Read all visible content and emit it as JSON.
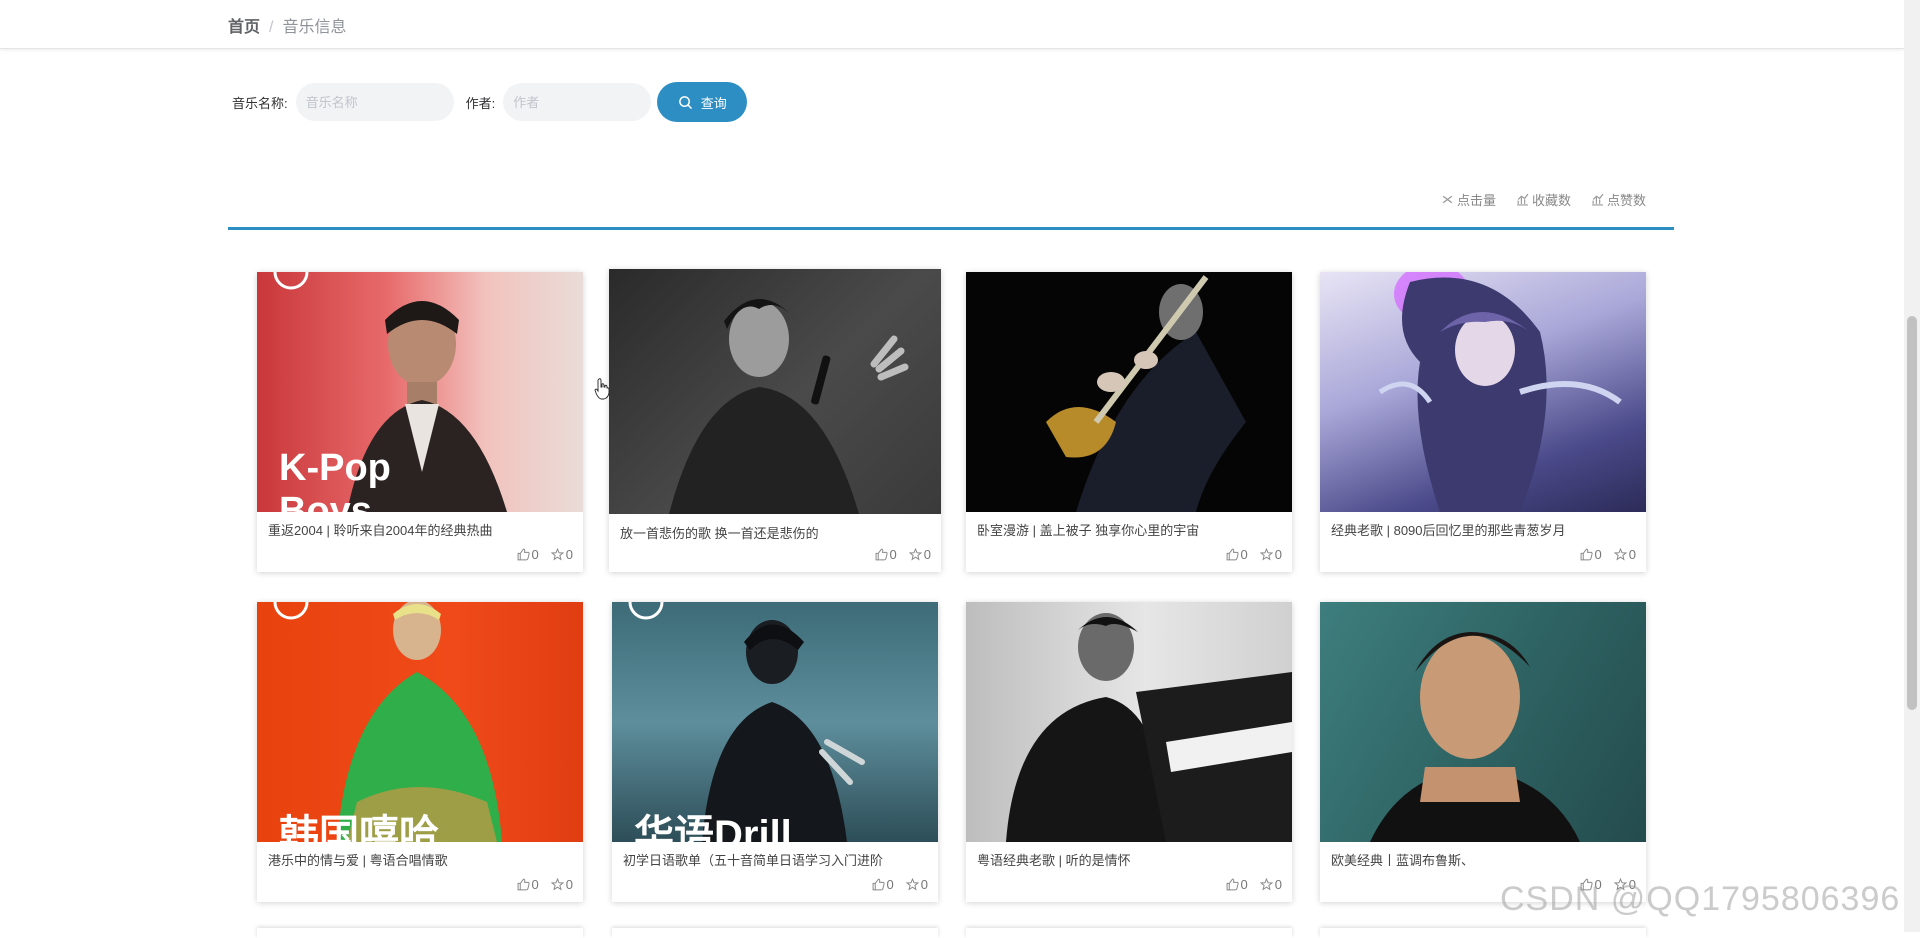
{
  "breadcrumb": {
    "home": "首页",
    "separator": "/",
    "current": "音乐信息"
  },
  "search": {
    "name_label": "音乐名称:",
    "name_placeholder": "音乐名称",
    "author_label": "作者:",
    "author_placeholder": "作者",
    "button_label": "查询"
  },
  "sorts": [
    {
      "label": "点击量",
      "icon": "sort-icon"
    },
    {
      "label": "收藏数",
      "icon": "chart-icon"
    },
    {
      "label": "点赞数",
      "icon": "chart-icon"
    }
  ],
  "cards": [
    {
      "title": "重返2004 | 聆听来自2004年的经典热曲",
      "likes": "0",
      "favorites": "0",
      "cover_text": "K-Pop",
      "cover_text2": "Boys"
    },
    {
      "title": "放一首悲伤的歌 换一首还是悲伤的",
      "likes": "0",
      "favorites": "0"
    },
    {
      "title": "卧室漫游 | 盖上被子 独享你心里的宇宙",
      "likes": "0",
      "favorites": "0"
    },
    {
      "title": "经典老歌 | 8090后回忆里的那些青葱岁月",
      "likes": "0",
      "favorites": "0"
    },
    {
      "title": "港乐中的情与爱 | 粤语合唱情歌",
      "likes": "0",
      "favorites": "0",
      "cover_text": "韩国嘻哈"
    },
    {
      "title": "初学日语歌单（五十音简单日语学习入门进阶",
      "likes": "0",
      "favorites": "0",
      "cover_text": "华语Drill"
    },
    {
      "title": "粤语经典老歌 | 听的是情怀",
      "likes": "0",
      "favorites": "0"
    },
    {
      "title": "欧美经典丨蓝调布鲁斯、",
      "likes": "0",
      "favorites": "0"
    }
  ],
  "watermark": "CSDN @QQ1795806396",
  "colors": {
    "accent": "#2d8ec4"
  }
}
